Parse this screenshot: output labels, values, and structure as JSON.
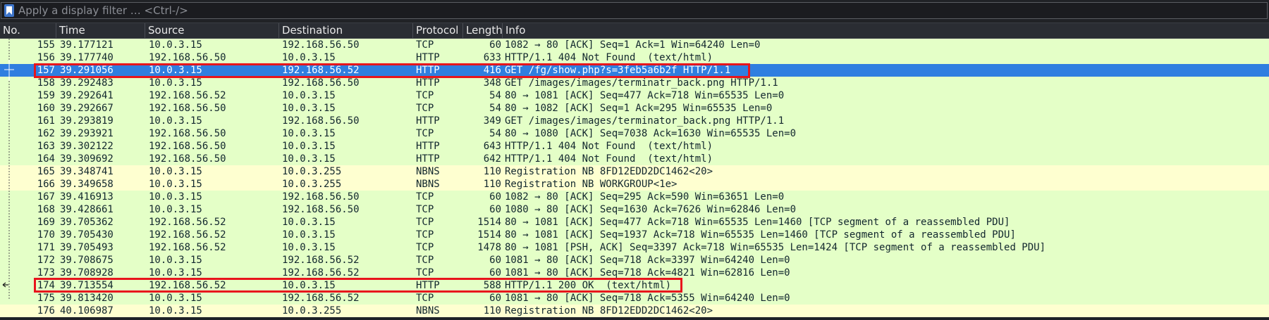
{
  "filter": {
    "placeholder": "Apply a display filter … <Ctrl-/>"
  },
  "columns": {
    "no": "No.",
    "time": "Time",
    "source": "Source",
    "destination": "Destination",
    "protocol": "Protocol",
    "length": "Length",
    "info": "Info"
  },
  "colors": {
    "tcp_http_bg": "#e4ffc7",
    "nbns_bg": "#feffd0",
    "selected_bg": "#2f7ee0",
    "annotation": "#e8141c"
  },
  "packets": [
    {
      "no": "155",
      "time": "39.177121",
      "src": "10.0.3.15",
      "dst": "192.168.56.50",
      "proto": "TCP",
      "len": "60",
      "info": "1082 → 80 [ACK] Seq=1 Ack=1 Win=64240 Len=0",
      "type": "tcp"
    },
    {
      "no": "156",
      "time": "39.177740",
      "src": "192.168.56.50",
      "dst": "10.0.3.15",
      "proto": "HTTP",
      "len": "633",
      "info": "HTTP/1.1 404 Not Found  (text/html)",
      "type": "http"
    },
    {
      "no": "157",
      "time": "39.291056",
      "src": "10.0.3.15",
      "dst": "192.168.56.52",
      "proto": "HTTP",
      "len": "416",
      "info": "GET /fg/show.php?s=3feb5a6b2f HTTP/1.1",
      "type": "selected"
    },
    {
      "no": "158",
      "time": "39.292483",
      "src": "10.0.3.15",
      "dst": "192.168.56.50",
      "proto": "HTTP",
      "len": "348",
      "info": "GET /images/images/terminatr_back.png HTTP/1.1",
      "type": "http"
    },
    {
      "no": "159",
      "time": "39.292641",
      "src": "192.168.56.52",
      "dst": "10.0.3.15",
      "proto": "TCP",
      "len": "54",
      "info": "80 → 1081 [ACK] Seq=477 Ack=718 Win=65535 Len=0",
      "type": "tcp"
    },
    {
      "no": "160",
      "time": "39.292667",
      "src": "192.168.56.50",
      "dst": "10.0.3.15",
      "proto": "TCP",
      "len": "54",
      "info": "80 → 1082 [ACK] Seq=1 Ack=295 Win=65535 Len=0",
      "type": "tcp"
    },
    {
      "no": "161",
      "time": "39.293819",
      "src": "10.0.3.15",
      "dst": "192.168.56.50",
      "proto": "HTTP",
      "len": "349",
      "info": "GET /images/images/terminator_back.png HTTP/1.1",
      "type": "http"
    },
    {
      "no": "162",
      "time": "39.293921",
      "src": "192.168.56.50",
      "dst": "10.0.3.15",
      "proto": "TCP",
      "len": "54",
      "info": "80 → 1080 [ACK] Seq=7038 Ack=1630 Win=65535 Len=0",
      "type": "tcp"
    },
    {
      "no": "163",
      "time": "39.302122",
      "src": "192.168.56.50",
      "dst": "10.0.3.15",
      "proto": "HTTP",
      "len": "643",
      "info": "HTTP/1.1 404 Not Found  (text/html)",
      "type": "http"
    },
    {
      "no": "164",
      "time": "39.309692",
      "src": "192.168.56.50",
      "dst": "10.0.3.15",
      "proto": "HTTP",
      "len": "642",
      "info": "HTTP/1.1 404 Not Found  (text/html)",
      "type": "http"
    },
    {
      "no": "165",
      "time": "39.348741",
      "src": "10.0.3.15",
      "dst": "10.0.3.255",
      "proto": "NBNS",
      "len": "110",
      "info": "Registration NB 8FD12EDD2DC1462<20>",
      "type": "nbns"
    },
    {
      "no": "166",
      "time": "39.349658",
      "src": "10.0.3.15",
      "dst": "10.0.3.255",
      "proto": "NBNS",
      "len": "110",
      "info": "Registration NB WORKGROUP<1e>",
      "type": "nbns"
    },
    {
      "no": "167",
      "time": "39.416913",
      "src": "10.0.3.15",
      "dst": "192.168.56.50",
      "proto": "TCP",
      "len": "60",
      "info": "1082 → 80 [ACK] Seq=295 Ack=590 Win=63651 Len=0",
      "type": "tcp"
    },
    {
      "no": "168",
      "time": "39.428661",
      "src": "10.0.3.15",
      "dst": "192.168.56.50",
      "proto": "TCP",
      "len": "60",
      "info": "1080 → 80 [ACK] Seq=1630 Ack=7626 Win=62846 Len=0",
      "type": "tcp"
    },
    {
      "no": "169",
      "time": "39.705362",
      "src": "192.168.56.52",
      "dst": "10.0.3.15",
      "proto": "TCP",
      "len": "1514",
      "info": "80 → 1081 [ACK] Seq=477 Ack=718 Win=65535 Len=1460 [TCP segment of a reassembled PDU]",
      "type": "tcp"
    },
    {
      "no": "170",
      "time": "39.705430",
      "src": "192.168.56.52",
      "dst": "10.0.3.15",
      "proto": "TCP",
      "len": "1514",
      "info": "80 → 1081 [ACK] Seq=1937 Ack=718 Win=65535 Len=1460 [TCP segment of a reassembled PDU]",
      "type": "tcp"
    },
    {
      "no": "171",
      "time": "39.705493",
      "src": "192.168.56.52",
      "dst": "10.0.3.15",
      "proto": "TCP",
      "len": "1478",
      "info": "80 → 1081 [PSH, ACK] Seq=3397 Ack=718 Win=65535 Len=1424 [TCP segment of a reassembled PDU]",
      "type": "tcp"
    },
    {
      "no": "172",
      "time": "39.708675",
      "src": "10.0.3.15",
      "dst": "192.168.56.52",
      "proto": "TCP",
      "len": "60",
      "info": "1081 → 80 [ACK] Seq=718 Ack=3397 Win=64240 Len=0",
      "type": "tcp"
    },
    {
      "no": "173",
      "time": "39.708928",
      "src": "10.0.3.15",
      "dst": "192.168.56.52",
      "proto": "TCP",
      "len": "60",
      "info": "1081 → 80 [ACK] Seq=718 Ack=4821 Win=62816 Len=0",
      "type": "tcp"
    },
    {
      "no": "174",
      "time": "39.713554",
      "src": "192.168.56.52",
      "dst": "10.0.3.15",
      "proto": "HTTP",
      "len": "588",
      "info": "HTTP/1.1 200 OK  (text/html)",
      "type": "http"
    },
    {
      "no": "175",
      "time": "39.813420",
      "src": "10.0.3.15",
      "dst": "192.168.56.52",
      "proto": "TCP",
      "len": "60",
      "info": "1081 → 80 [ACK] Seq=718 Ack=5355 Win=64240 Len=0",
      "type": "tcp"
    },
    {
      "no": "176",
      "time": "40.106987",
      "src": "10.0.3.15",
      "dst": "10.0.3.255",
      "proto": "NBNS",
      "len": "110",
      "info": "Registration NB 8FD12EDD2DC1462<20>",
      "type": "nbns"
    }
  ]
}
